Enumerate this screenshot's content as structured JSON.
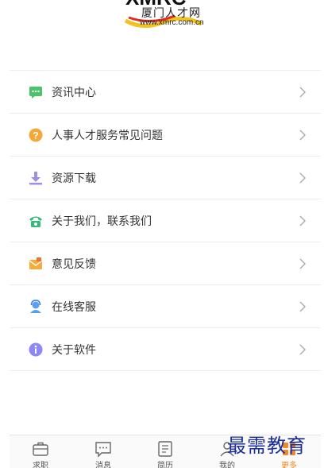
{
  "header": {
    "logo_mark": "XMRC",
    "logo_cn": "厦门人才网",
    "logo_url": "www.xmrc.com.cn"
  },
  "menu": {
    "items": [
      {
        "label": "资讯中心",
        "icon": "message-icon",
        "color": "#4cc36b"
      },
      {
        "label": "人事人才服务常见问题",
        "icon": "question-icon",
        "color": "#f5a83a"
      },
      {
        "label": "资源下载",
        "icon": "download-icon",
        "color": "#9d8ee8"
      },
      {
        "label": "关于我们，联系我们",
        "icon": "phone-icon",
        "color": "#36b97a"
      },
      {
        "label": "意见反馈",
        "icon": "mail-icon",
        "color": "#f5ac3b"
      },
      {
        "label": "在线客服",
        "icon": "agent-icon",
        "color": "#5a9ff0"
      },
      {
        "label": "关于软件",
        "icon": "info-icon",
        "color": "#8f88f2"
      }
    ]
  },
  "tabbar": {
    "tabs": [
      {
        "label": "求职",
        "icon": "briefcase-icon"
      },
      {
        "label": "消息",
        "icon": "chat-icon"
      },
      {
        "label": "简历",
        "icon": "resume-icon"
      },
      {
        "label": "我的",
        "icon": "person-icon"
      },
      {
        "label": "更多",
        "icon": "more-icon",
        "active": true
      }
    ],
    "active_color": "#f0882a"
  },
  "watermark": "最需教育"
}
